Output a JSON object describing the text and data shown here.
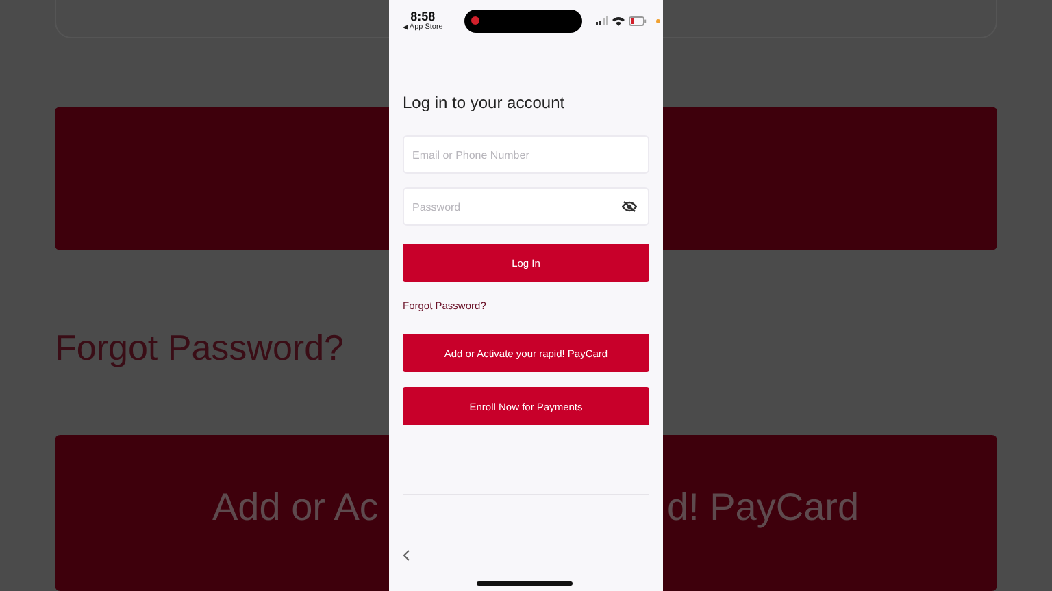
{
  "background": {
    "link": "Forgot Password?",
    "button_left": "Add or Ac",
    "button_right": "d! PayCard"
  },
  "status_bar": {
    "time": "8:58",
    "back_app": "App Store",
    "recording": true
  },
  "title": "Log in to your account",
  "email": {
    "placeholder": "Email or Phone Number"
  },
  "password": {
    "placeholder": "Password"
  },
  "login_button": "Log In",
  "forgot_link": "Forgot Password?",
  "buttons": [
    "Add or Activate your rapid! PayCard",
    "Enroll Now for Payments"
  ]
}
